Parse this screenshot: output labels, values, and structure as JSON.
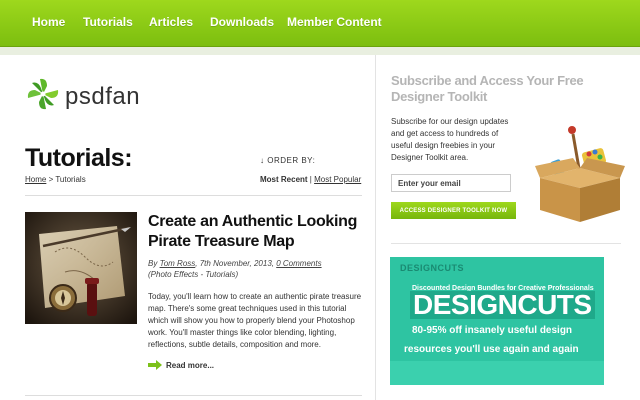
{
  "nav": {
    "items": [
      "Home",
      "Tutorials",
      "Articles",
      "Downloads",
      "Member Content"
    ]
  },
  "logo": {
    "text": "psdfan",
    "brand_color": "#6cbf1f"
  },
  "content": {
    "heading": "Tutorials:",
    "breadcrumb": {
      "home": "Home",
      "separator": " > ",
      "current": "Tutorials"
    },
    "order_by_label": "↓ ORDER BY:",
    "order_options": {
      "active": "Most Recent",
      "separator": " | ",
      "alt": "Most Popular"
    }
  },
  "post": {
    "title": "Create an Authentic Looking Pirate Treasure Map",
    "by": "By ",
    "author": "Tom Ross",
    "date": ", 7th November, 2013, ",
    "comments": "0 Comments",
    "category": "(Photo Effects - Tutorials)",
    "excerpt": "Today, you'll learn how to create an authentic pirate treasure map. There's some great techniques used in this tutorial which will show you how to properly blend your Photoshop work. You'll master things like color blending, lighting, reflections, subtle details, composition and more.",
    "read_more": "Read more..."
  },
  "sidebar": {
    "title": "Subscribe and Access Your Free Designer Toolkit",
    "description": "Subscribe for our design updates and get access to hundreds of useful design freebies in your Designer Toolkit area.",
    "email_placeholder": "Enter your email",
    "button_label": "ACCESS DESIGNER TOOLKIT NOW"
  },
  "ad": {
    "logo": "DESIGNCUTS",
    "subtitle": "Discounted Design Bundles for Creative Professionals",
    "headline": "DESIGNCUTS",
    "line1": "80-95% off insanely useful design",
    "line2": "resources you'll use again and again"
  },
  "colors": {
    "accent_green": "#8ccd16",
    "ad_teal": "#2ec4a2",
    "sidebar_title": "#b5b5b5"
  }
}
